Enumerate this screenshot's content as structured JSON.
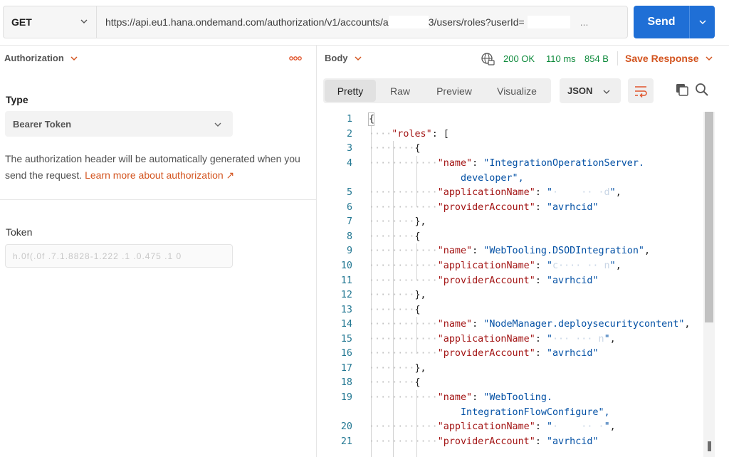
{
  "request": {
    "method": "GET",
    "url_prefix": "https://api.eu1.hana.ondemand.com/authorization/v1/accounts/a",
    "url_mid": "3/users/roles?userId=",
    "url_tail": "...",
    "send_label": "Send"
  },
  "auth": {
    "tab_label": "Authorization",
    "type_label": "Type",
    "type_value": "Bearer Token",
    "description": "The authorization header will be automatically generated when you send the request.",
    "learn_more": "Learn more about authorization ↗",
    "token_label": "Token",
    "token_value": "h.0f(.0f .7.1.8828-1.222 .1 .0.475 .1 0"
  },
  "response": {
    "body_label": "Body",
    "status": "200 OK",
    "time": "110 ms",
    "size": "854 B",
    "save_label": "Save Response",
    "tabs": [
      "Pretty",
      "Raw",
      "Preview",
      "Visualize"
    ],
    "format": "JSON"
  },
  "code": {
    "line_numbers": [
      "1",
      "2",
      "3",
      "4",
      "",
      "5",
      "6",
      "7",
      "8",
      "9",
      "10",
      "11",
      "12",
      "13",
      "14",
      "15",
      "16",
      "17",
      "18",
      "19",
      "",
      "20",
      "21"
    ]
  },
  "roles": [
    {
      "name": "IntegrationOperationServer.",
      "name_cont": "developer\",",
      "applicationName": "·    ·· ·d",
      "providerAccount": "avrhcid"
    },
    {
      "name": "WebTooling.DSODIntegration",
      "applicationName": "c···· ·· n",
      "providerAccount": "avrhcid"
    },
    {
      "name": "NodeManager.deploysecuritycontent",
      "applicationName": "··· ··· n",
      "providerAccount": "avrhcid"
    },
    {
      "name": "WebTooling.",
      "name_cont": "IntegrationFlowConfigure\",",
      "applicationName": "·    ·· ·",
      "providerAccount": "avrhcid"
    }
  ],
  "colors": {
    "accent": "#1f6fd6",
    "status_ok": "#0d8a3b",
    "link": "#d3541f",
    "json_key": "#a31515",
    "json_string": "#0451a5",
    "line_number": "#237893"
  },
  "icons": [
    "chevron-down-icon",
    "more-icon",
    "globe-icon",
    "wrap-icon",
    "copy-icon",
    "search-icon"
  ]
}
